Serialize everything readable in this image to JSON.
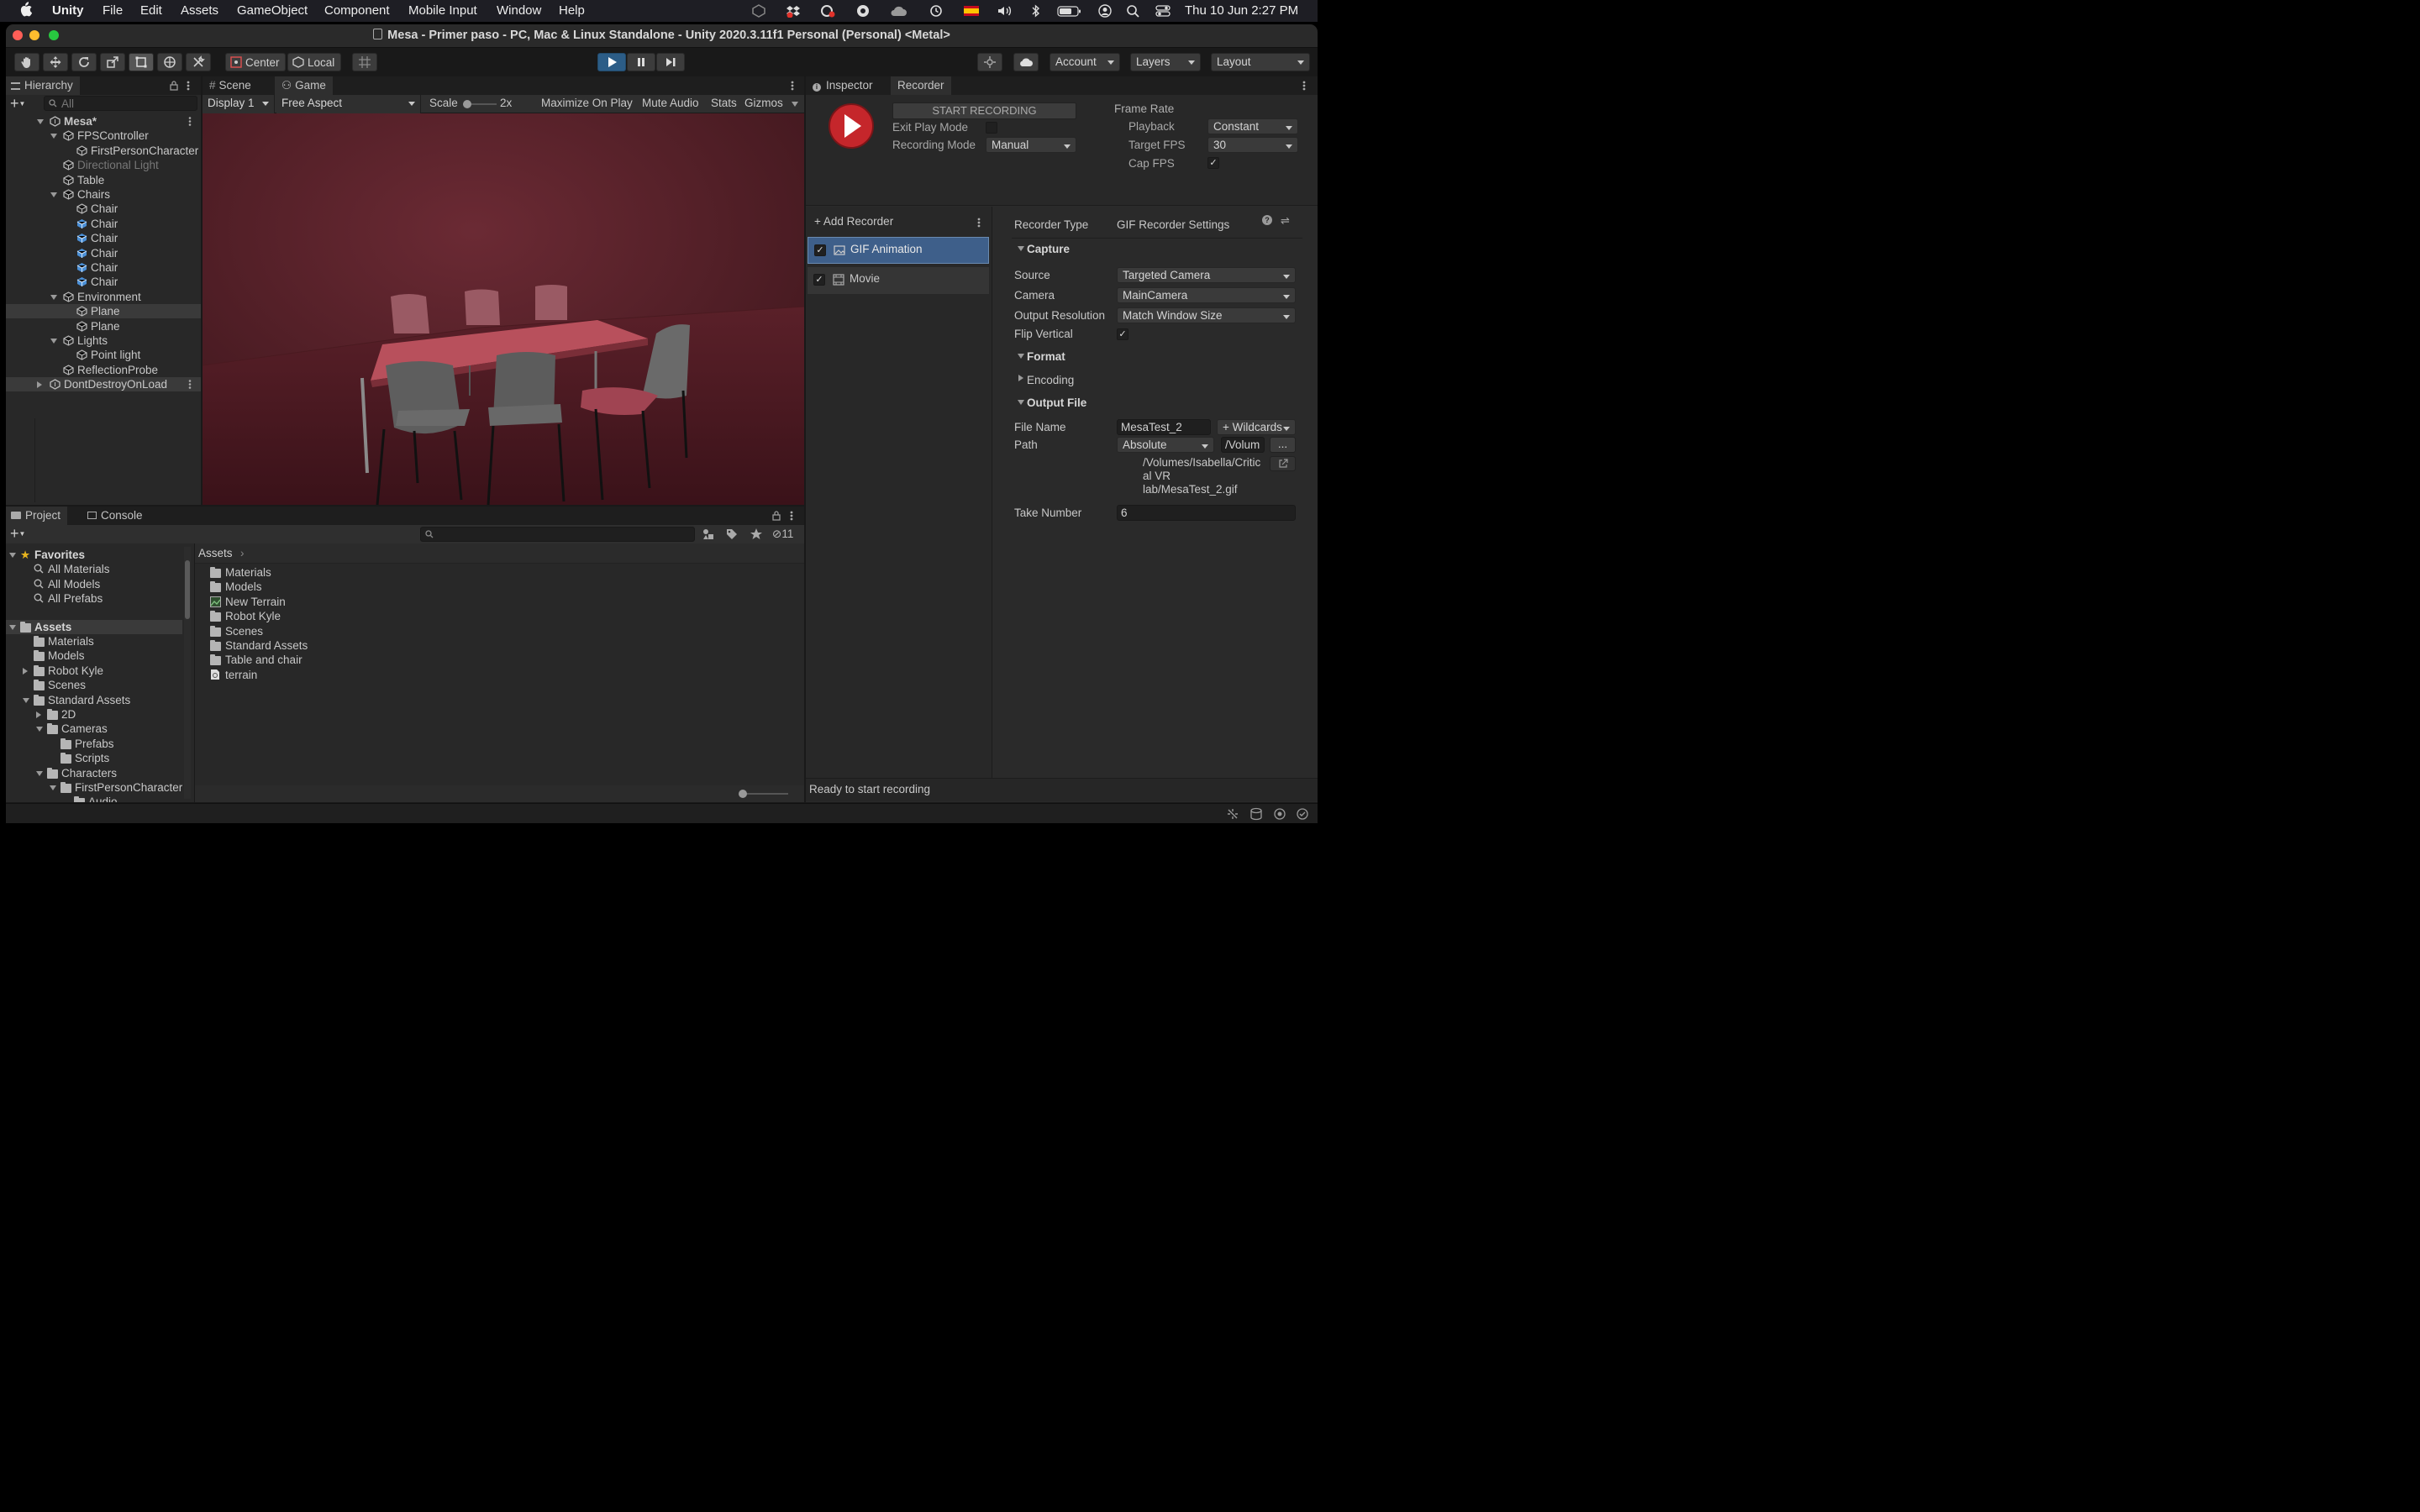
{
  "menubar": {
    "app": "Unity",
    "items": [
      "File",
      "Edit",
      "Assets",
      "GameObject",
      "Component",
      "Mobile Input",
      "Window",
      "Help"
    ],
    "clock": "Thu 10 Jun  2:27 PM"
  },
  "window": {
    "title": "Mesa - Primer paso - PC, Mac & Linux Standalone - Unity 2020.3.11f1 Personal (Personal) <Metal>"
  },
  "toolbar": {
    "center": "Center",
    "local": "Local",
    "account": "Account",
    "layers": "Layers",
    "layout": "Layout"
  },
  "hierarchy": {
    "tab": "Hierarchy",
    "search_placeholder": "All",
    "items": [
      {
        "label": "Mesa*",
        "depth": 0,
        "expand": "open",
        "icon": "scene",
        "bold": true
      },
      {
        "label": "FPSController",
        "depth": 1,
        "expand": "open",
        "icon": "gameobject"
      },
      {
        "label": "FirstPersonCharacter",
        "depth": 2,
        "expand": "none",
        "icon": "gameobject"
      },
      {
        "label": "Directional Light",
        "depth": 1,
        "expand": "none",
        "icon": "gameobject",
        "dim": true
      },
      {
        "label": "Table",
        "depth": 1,
        "expand": "none",
        "icon": "gameobject"
      },
      {
        "label": "Chairs",
        "depth": 1,
        "expand": "open",
        "icon": "gameobject"
      },
      {
        "label": "Chair",
        "depth": 2,
        "expand": "none",
        "icon": "gameobject"
      },
      {
        "label": "Chair",
        "depth": 2,
        "expand": "none",
        "icon": "prefab"
      },
      {
        "label": "Chair",
        "depth": 2,
        "expand": "none",
        "icon": "prefab"
      },
      {
        "label": "Chair",
        "depth": 2,
        "expand": "none",
        "icon": "prefab"
      },
      {
        "label": "Chair",
        "depth": 2,
        "expand": "none",
        "icon": "prefab"
      },
      {
        "label": "Chair",
        "depth": 2,
        "expand": "none",
        "icon": "prefab"
      },
      {
        "label": "Environment",
        "depth": 1,
        "expand": "open",
        "icon": "gameobject"
      },
      {
        "label": "Plane",
        "depth": 2,
        "expand": "none",
        "icon": "gameobject",
        "selected": true
      },
      {
        "label": "Plane",
        "depth": 2,
        "expand": "none",
        "icon": "gameobject"
      },
      {
        "label": "Lights",
        "depth": 1,
        "expand": "open",
        "icon": "gameobject"
      },
      {
        "label": "Point light",
        "depth": 2,
        "expand": "none",
        "icon": "gameobject"
      },
      {
        "label": "ReflectionProbe",
        "depth": 1,
        "expand": "none",
        "icon": "gameobject"
      },
      {
        "label": "DontDestroyOnLoad",
        "depth": 0,
        "expand": "closed",
        "icon": "scene",
        "header": true
      }
    ]
  },
  "game": {
    "tab_scene": "Scene",
    "tab_game": "Game",
    "display": "Display 1",
    "aspect": "Free Aspect",
    "scale_label": "Scale",
    "scale_value": "2x",
    "maximize": "Maximize On Play",
    "mute": "Mute Audio",
    "stats": "Stats",
    "gizmos": "Gizmos"
  },
  "project": {
    "tab_project": "Project",
    "tab_console": "Console",
    "hidden_count": "11",
    "tree": [
      {
        "label": "Favorites",
        "depth": 0,
        "expand": "open",
        "icon": "star",
        "bold": true
      },
      {
        "label": "All Materials",
        "depth": 1,
        "expand": "none",
        "icon": "search"
      },
      {
        "label": "All Models",
        "depth": 1,
        "expand": "none",
        "icon": "search"
      },
      {
        "label": "All Prefabs",
        "depth": 1,
        "expand": "none",
        "icon": "search"
      },
      {
        "label": "",
        "depth": 0,
        "expand": "gap",
        "icon": "none"
      },
      {
        "label": "Assets",
        "depth": 0,
        "expand": "open",
        "icon": "folder",
        "bold": true,
        "header": true
      },
      {
        "label": "Materials",
        "depth": 1,
        "expand": "none",
        "icon": "folder"
      },
      {
        "label": "Models",
        "depth": 1,
        "expand": "none",
        "icon": "folder"
      },
      {
        "label": "Robot Kyle",
        "depth": 1,
        "expand": "closed",
        "icon": "folder"
      },
      {
        "label": "Scenes",
        "depth": 1,
        "expand": "none",
        "icon": "folder"
      },
      {
        "label": "Standard Assets",
        "depth": 1,
        "expand": "open",
        "icon": "folder"
      },
      {
        "label": "2D",
        "depth": 2,
        "expand": "closed",
        "icon": "folder"
      },
      {
        "label": "Cameras",
        "depth": 2,
        "expand": "open",
        "icon": "folder"
      },
      {
        "label": "Prefabs",
        "depth": 3,
        "expand": "none",
        "icon": "folder"
      },
      {
        "label": "Scripts",
        "depth": 3,
        "expand": "none",
        "icon": "folder"
      },
      {
        "label": "Characters",
        "depth": 2,
        "expand": "open",
        "icon": "folder"
      },
      {
        "label": "FirstPersonCharacter",
        "depth": 3,
        "expand": "open",
        "icon": "folder"
      },
      {
        "label": "Audio",
        "depth": 4,
        "expand": "none",
        "icon": "folder"
      }
    ],
    "breadcrumb": "Assets",
    "assets": [
      {
        "label": "Materials",
        "icon": "folder"
      },
      {
        "label": "Models",
        "icon": "folder"
      },
      {
        "label": "New Terrain",
        "icon": "terrain"
      },
      {
        "label": "Robot Kyle",
        "icon": "folder"
      },
      {
        "label": "Scenes",
        "icon": "folder"
      },
      {
        "label": "Standard Assets",
        "icon": "folder"
      },
      {
        "label": "Table and chair",
        "icon": "folder"
      },
      {
        "label": "terrain",
        "icon": "file"
      }
    ]
  },
  "inspector": {
    "tab_inspector": "Inspector",
    "tab_recorder": "Recorder"
  },
  "recorder": {
    "start_recording": "START RECORDING",
    "exit_play_mode": "Exit Play Mode",
    "recording_mode_label": "Recording Mode",
    "recording_mode": "Manual",
    "frame_rate": "Frame Rate",
    "playback_label": "Playback",
    "playback": "Constant",
    "target_fps_label": "Target FPS",
    "target_fps": "30",
    "cap_fps_label": "Cap FPS",
    "add_recorder": "+ Add Recorder",
    "list": [
      "GIF Animation",
      "Movie"
    ],
    "recorder_type_label": "Recorder Type",
    "recorder_type": "GIF Recorder Settings",
    "capture": "Capture",
    "source_label": "Source",
    "source": "Targeted Camera",
    "camera_label": "Camera",
    "camera": "MainCamera",
    "output_resolution_label": "Output Resolution",
    "output_resolution": "Match Window Size",
    "flip_vertical_label": "Flip Vertical",
    "format": "Format",
    "encoding": "Encoding",
    "output_file": "Output File",
    "file_name_label": "File Name",
    "file_name": "MesaTest_2",
    "wildcards": "+ Wildcards",
    "path_label": "Path",
    "path_mode": "Absolute",
    "path_value": "/Volum",
    "browse": "...",
    "full_path_lines": [
      "/Volumes/Isabella/Critic",
      "al VR",
      "lab/MesaTest_2.gif"
    ],
    "take_number_label": "Take Number",
    "take_number": "6",
    "status": "Ready to start recording"
  },
  "colors": {
    "accent": "#2c5d87",
    "selection": "#3e5f8a"
  }
}
